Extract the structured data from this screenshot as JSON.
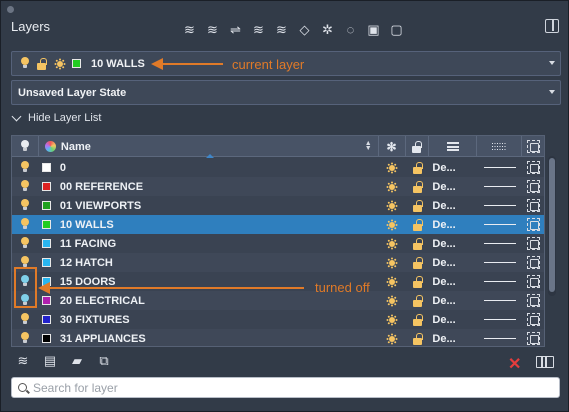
{
  "panel": {
    "title": "Layers"
  },
  "toolbar": {
    "icons": [
      "new-layer-icon",
      "new-layer-vp-frozen-icon",
      "delete-layer-icon",
      "set-current-icon",
      "layer-walk-icon",
      "isolate-icon",
      "freeze-icon",
      "off-icon",
      "lock-icon",
      "unlock-icon"
    ]
  },
  "current_layer": {
    "name": "10 WALLS",
    "color": "#22cc22"
  },
  "layer_state": {
    "value": "Unsaved Layer State"
  },
  "toggle": {
    "label": "Hide Layer List"
  },
  "table": {
    "headers": {
      "name": "Name"
    },
    "rows": [
      {
        "name": "0",
        "color": "#ffffff",
        "on": true,
        "linetype": "De..."
      },
      {
        "name": "00 REFERENCE",
        "color": "#dd2222",
        "on": true,
        "linetype": "De..."
      },
      {
        "name": "01 VIEWPORTS",
        "color": "#1fa01f",
        "on": true,
        "linetype": "De..."
      },
      {
        "name": "10 WALLS",
        "color": "#22cc22",
        "on": true,
        "linetype": "De...",
        "selected": true
      },
      {
        "name": "11 FACING",
        "color": "#29b6f0",
        "on": true,
        "linetype": "De..."
      },
      {
        "name": "12 HATCH",
        "color": "#29b6f0",
        "on": true,
        "linetype": "De..."
      },
      {
        "name": "15 DOORS",
        "color": "#29b6f0",
        "on": false,
        "linetype": "De..."
      },
      {
        "name": "20 ELECTRICAL",
        "color": "#b020b0",
        "on": false,
        "linetype": "De..."
      },
      {
        "name": "30 FIXTURES",
        "color": "#2222cc",
        "on": true,
        "linetype": "De..."
      },
      {
        "name": "31 APPLIANCES",
        "color": "#000000",
        "on": true,
        "linetype": "De..."
      }
    ]
  },
  "search": {
    "placeholder": "Search for layer"
  },
  "annotations": {
    "current": "current layer",
    "off": "turned off",
    "color": "#e07a28"
  }
}
